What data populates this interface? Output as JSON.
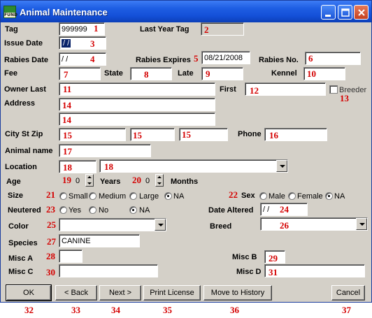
{
  "window": {
    "title": "Animal Maintenance",
    "logo_text": "FUND"
  },
  "labels": {
    "tag": "Tag",
    "last_year_tag": "Last Year Tag",
    "issue_date": "Issue Date",
    "rabies_date": "Rabies Date",
    "rabies_expires": "Rabies Expires",
    "rabies_no": "Rabies No.",
    "fee": "Fee",
    "state": "State",
    "late": "Late",
    "kennel": "Kennel",
    "owner_last": "Owner Last",
    "first": "First",
    "breeder": "Breeder",
    "address": "Address",
    "city_st_zip": "City St Zip",
    "phone": "Phone",
    "animal_name": "Animal name",
    "location": "Location",
    "age": "Age",
    "years": "Years",
    "months": "Months",
    "size": "Size",
    "sex": "Sex",
    "neutered": "Neutered",
    "date_altered": "Date Altered",
    "color": "Color",
    "breed": "Breed",
    "species": "Species",
    "misc_a": "Misc A",
    "misc_b": "Misc B",
    "misc_c": "Misc C",
    "misc_d": "Misc D"
  },
  "values": {
    "tag": "999999",
    "issue_date": " / /",
    "rabies_date": " / /",
    "rabies_expires": "08/21/2008",
    "age_years": "0",
    "age_months": "0",
    "date_altered": " / /",
    "species": "CANINE"
  },
  "radios": {
    "size": [
      "Small",
      "Medium",
      "Large",
      "NA"
    ],
    "size_selected": "NA",
    "sex": [
      "Male",
      "Female",
      "NA"
    ],
    "sex_selected": "NA",
    "neutered": [
      "Yes",
      "No",
      "NA"
    ],
    "neutered_selected": "NA"
  },
  "buttons": {
    "ok": "OK",
    "back": "< Back",
    "next": "Next >",
    "print": "Print License",
    "history": "Move to History",
    "cancel": "Cancel"
  },
  "markers": {
    "n1": "1",
    "n2": "2",
    "n3": "3",
    "n4": "4",
    "n5": "5",
    "n6": "6",
    "n7": "7",
    "n8": "8",
    "n9": "9",
    "n10": "10",
    "n11": "11",
    "n12": "12",
    "n13": "13",
    "n14a": "14",
    "n14b": "14",
    "n15a": "15",
    "n15b": "15",
    "n15c": "15",
    "n16": "16",
    "n17": "17",
    "n18a": "18",
    "n18b": "18",
    "n19": "19",
    "n20": "20",
    "n21": "21",
    "n22": "22",
    "n23": "23",
    "n24": "24",
    "n25": "25",
    "n26": "26",
    "n27": "27",
    "n28": "28",
    "n29": "29",
    "n30": "30",
    "n31": "31",
    "n32": "32",
    "n33": "33",
    "n34": "34",
    "n35": "35",
    "n36": "36",
    "n37": "37"
  },
  "colors": {
    "title_bar": "#1e5ee3",
    "form_bg": "#d4d0c8",
    "marker": "#d40000",
    "selection": "#0a246a"
  }
}
